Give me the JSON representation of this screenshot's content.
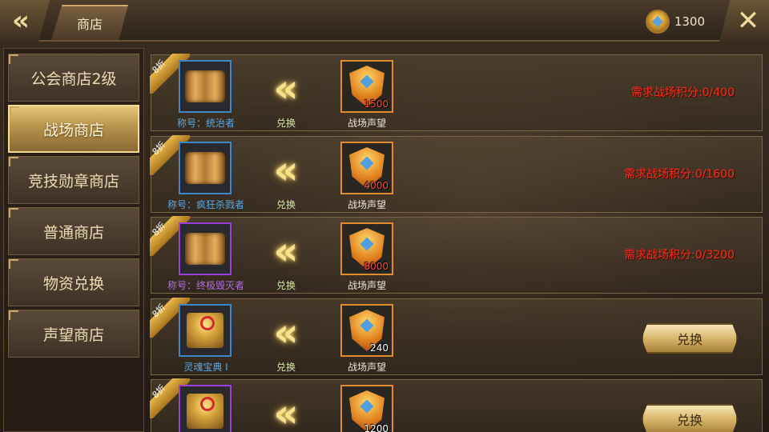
{
  "header": {
    "back_icon": "back-arrow-icon",
    "title": "商店",
    "currency_icon": "battle-honor-medal-icon",
    "currency_amount": "1300",
    "close_icon": "close-icon"
  },
  "sidebar": {
    "items": [
      {
        "label": "公会商店2级",
        "active": false
      },
      {
        "label": "战场商店",
        "active": true
      },
      {
        "label": "竞技勋章商店",
        "active": false
      },
      {
        "label": "普通商店",
        "active": false
      },
      {
        "label": "物资兑换",
        "active": false
      },
      {
        "label": "声望商店",
        "active": false
      }
    ]
  },
  "rows": [
    {
      "badge": "8折",
      "item_name": "称号：统治者",
      "item_rarity": "blue",
      "item_icon": "scroll-icon",
      "exchange_label": "兑换",
      "cost_value": "1500",
      "cost_value_color": "red",
      "cost_name": "战场声望",
      "requirement": "需求战场积分:0/400",
      "button": ""
    },
    {
      "badge": "8折",
      "item_name": "称号：疯狂杀戮者",
      "item_rarity": "blue",
      "item_icon": "scroll-icon",
      "exchange_label": "兑换",
      "cost_value": "4000",
      "cost_value_color": "red",
      "cost_name": "战场声望",
      "requirement": "需求战场积分:0/1600",
      "button": ""
    },
    {
      "badge": "8折",
      "item_name": "称号：终极毁灭者",
      "item_rarity": "purple",
      "item_icon": "scroll-icon",
      "exchange_label": "兑换",
      "cost_value": "8000",
      "cost_value_color": "red",
      "cost_name": "战场声望",
      "requirement": "需求战场积分:0/3200",
      "button": ""
    },
    {
      "badge": "8折",
      "item_name": "灵魂宝典 I",
      "item_rarity": "blue",
      "item_icon": "book-icon",
      "exchange_label": "兑换",
      "cost_value": "240",
      "cost_value_color": "white",
      "cost_name": "战场声望",
      "requirement": "",
      "button": "兑换"
    },
    {
      "badge": "8折",
      "item_name": "",
      "item_rarity": "purple",
      "item_icon": "book-icon",
      "exchange_label": "",
      "cost_value": "1200",
      "cost_value_color": "white",
      "cost_name": "",
      "requirement": "",
      "button": "兑换"
    }
  ]
}
